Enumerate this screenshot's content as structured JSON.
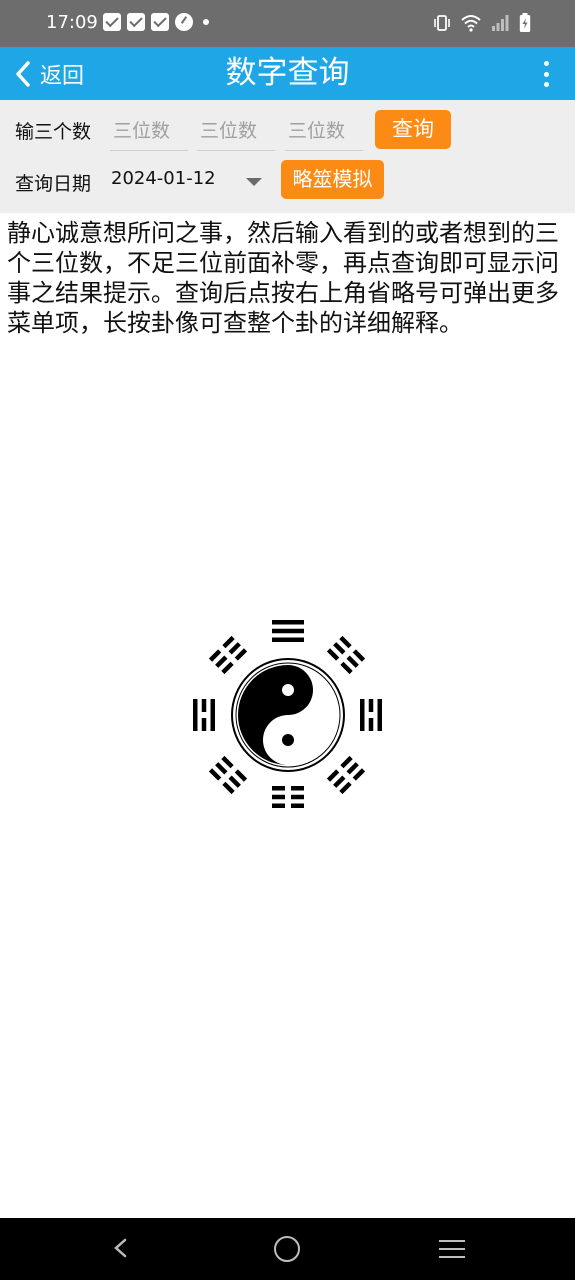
{
  "status_bar": {
    "time": "17:09"
  },
  "app_bar": {
    "back_label": "返回",
    "title": "数字查询"
  },
  "form": {
    "numbers_label": "输三个数",
    "input_placeholders": [
      "三位数",
      "三位数",
      "三位数"
    ],
    "query_button": "查询",
    "date_label": "查询日期",
    "date_value": "2024-01-12",
    "simulate_button": "略筮模拟"
  },
  "instructions": "静心诚意想所问之事，然后输入看到的或者想到的三个三位数，不足三位前面补零，再点查询即可显示问事之结果提示。查询后点按右上角省略号可弹出更多菜单项，长按卦像可查整个卦的详细解释。",
  "icons": {
    "status": [
      "mail-icon",
      "mail-icon",
      "mail-icon",
      "gauge-icon",
      "dot-icon",
      "vibrate-icon",
      "wifi-icon",
      "signal-icon",
      "battery-icon"
    ],
    "nav": [
      "nav-back-icon",
      "nav-home-icon",
      "nav-menu-icon"
    ]
  },
  "colors": {
    "app_bar": "#1ea6e6",
    "accent_button": "#fb8b14",
    "status_bar": "#6d6d6d"
  }
}
